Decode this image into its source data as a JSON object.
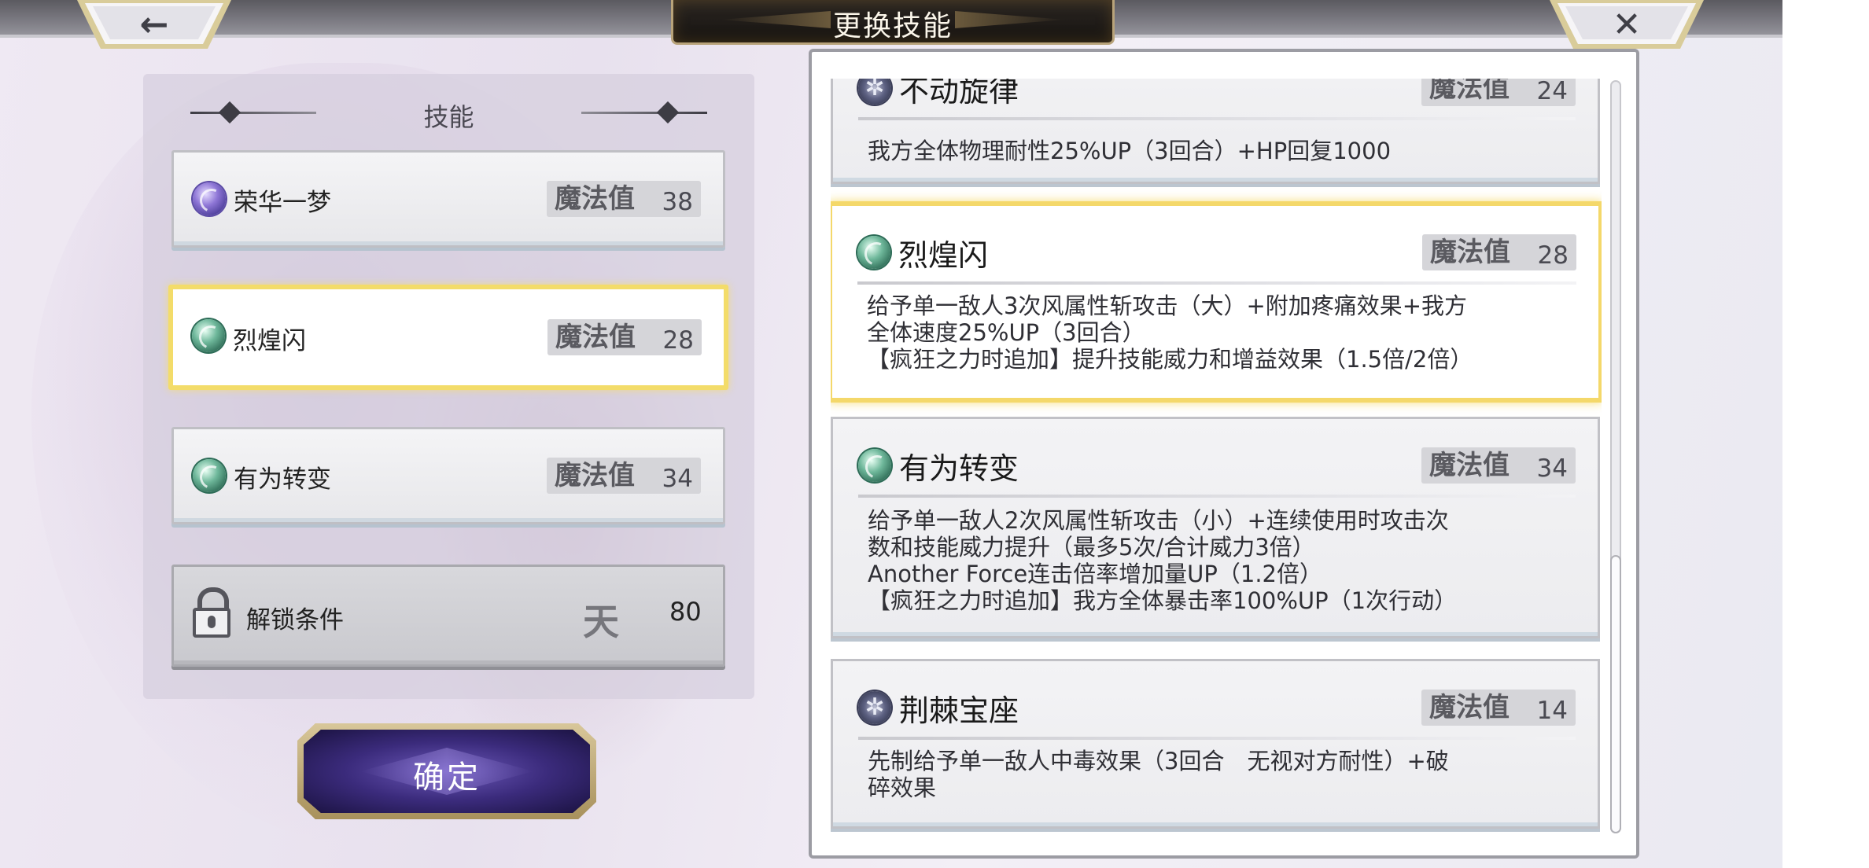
{
  "header": {
    "title": "更换技能"
  },
  "nav": {
    "back_icon": "arrow-left-icon",
    "close_icon": "close-x-icon"
  },
  "left_panel": {
    "heading": "技能",
    "slots": [
      {
        "name": "荣华一梦",
        "mp_label": "魔法值",
        "mp": "38",
        "orb": "purple"
      },
      {
        "name": "烈煌闪",
        "mp_label": "魔法值",
        "mp": "28",
        "orb": "green",
        "selected": true
      },
      {
        "name": "有为转变",
        "mp_label": "魔法值",
        "mp": "34",
        "orb": "green"
      }
    ],
    "locked": {
      "label": "解锁条件",
      "icon_text": "天",
      "value": "80"
    },
    "confirm_label": "确定"
  },
  "skill_list": [
    {
      "name": "不动旋律",
      "mp_label": "魔法值",
      "mp": "24",
      "orb": "dark",
      "desc": [
        "我方全体物理耐性25%UP（3回合）+HP回复1000"
      ]
    },
    {
      "name": "烈煌闪",
      "mp_label": "魔法值",
      "mp": "28",
      "orb": "green",
      "selected": true,
      "desc": [
        "给予单一敌人3次风属性斩攻击（大）+附加疼痛效果+我方",
        "全体速度25%UP（3回合）",
        "【疯狂之力时追加】提升技能威力和增益效果（1.5倍/2倍）"
      ]
    },
    {
      "name": "有为转变",
      "mp_label": "魔法值",
      "mp": "34",
      "orb": "green",
      "desc": [
        "给予单一敌人2次风属性斩攻击（小）+连续使用时攻击次",
        "数和技能威力提升（最多5次/合计威力3倍）",
        "Another Force连击倍率增加量UP（1.2倍）",
        "【疯狂之力时追加】我方全体暴击率100%UP（1次行动）"
      ]
    },
    {
      "name": "荆棘宝座",
      "mp_label": "魔法值",
      "mp": "14",
      "orb": "dark",
      "desc": [
        "先制给予单一敌人中毒效果（3回合　无视对方耐性）+破",
        "碎效果"
      ]
    }
  ],
  "colors": {
    "selected_border": "#f4d86a",
    "confirm_bg": "#3b2b7c"
  }
}
